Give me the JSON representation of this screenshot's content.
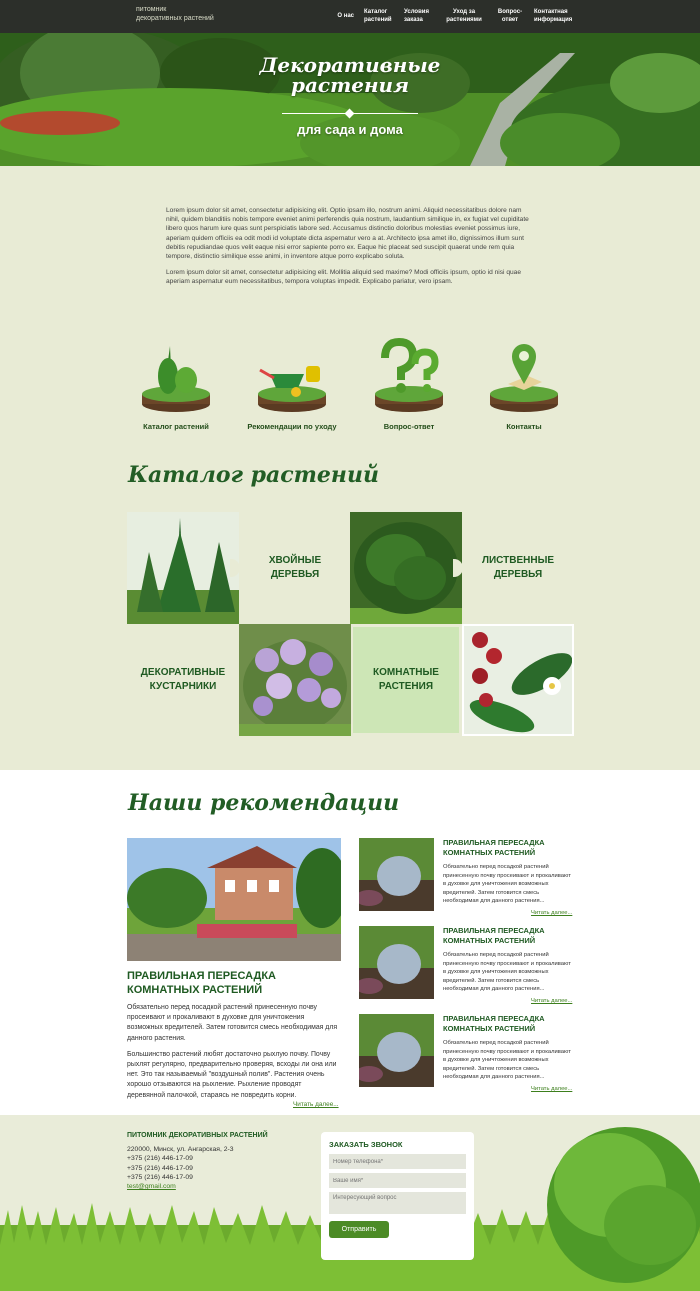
{
  "header": {
    "brand_line1": "питомник",
    "brand_line2": "декоративных растений",
    "nav": [
      "О нас",
      "Каталог растений",
      "Условия заказа",
      "Уход за растениями",
      "Вопрос-ответ",
      "Контактная информация"
    ]
  },
  "hero": {
    "title_line1": "Декоративные",
    "title_line2": "растения",
    "subtitle": "для сада и дома"
  },
  "intro": {
    "p1": "Lorem ipsum dolor sit amet, consectetur adipisicing elit. Optio ipsam illo, nostrum animi. Aliquid necessitatibus dolore nam nihil, quidem blanditiis nobis tempore eveniet animi perferendis quia nostrum, laudantium similique in, ex fugiat vel cupiditate libero quos harum iure quas sunt perspiciatis labore sed. Accusamus distinctio doloribus molestias eveniet possimus iure, aperiam quidem officiis ea odit modi id voluptate dicta aspernatur vero a at. Architecto ipsa amet illo, dignissimos illum sunt debitis repudiandae quos velit eaque nisi error sapiente porro ex. Eaque hic placeat sed suscipit quaerat unde rem quia tempore, distinctio similique esse animi, in inventore atque porro explicabo soluta.",
    "p2": "Lorem ipsum dolor sit amet, consectetur adipisicing elit. Mollitia aliquid sed maxime? Modi officiis ipsum, optio id nisi quae aperiam aspernatur eum necessitatibus, tempora voluptas impedit. Explicabo pariatur, vero ipsam."
  },
  "features": [
    "Каталог растений",
    "Рекомендации по уходу",
    "Вопрос-ответ",
    "Контакты"
  ],
  "catalog": {
    "title": "Каталог растений",
    "items": [
      {
        "line1": "ХВОЙНЫЕ",
        "line2": "ДЕРЕВЬЯ"
      },
      {
        "line1": "ЛИСТВЕННЫЕ",
        "line2": "ДЕРЕВЬЯ"
      },
      {
        "line1": "ДЕКОРАТИВНЫЕ",
        "line2": "КУСТАРНИКИ"
      },
      {
        "line1": "КОМНАТНЫЕ",
        "line2": "РАСТЕНИЯ"
      }
    ]
  },
  "recommendations": {
    "title": "Наши рекомендации",
    "main": {
      "heading_line1": "ПРАВИЛЬНАЯ ПЕРЕСАДКА",
      "heading_line2": "КОМНАТНЫХ РАСТЕНИЙ",
      "p1": "Обязательно перед посадкой растений принесенную почву просеивают и прокаливают в духовке для уничтожения возможных вредителей. Затем готовится смесь необходимая для данного растения.",
      "p2": "Большинство растений любят достаточно рыхлую почву. Почву рыхлят регулярно, предварительно проверяя, всходы ли она или нет. Это так называемый \"воздушный полив\". Растения очень хорошо отзываются на рыхление. Рыхление проводят деревянной палочкой, стараясь не повредить корни.",
      "read_more": "Читать далее..."
    },
    "side": [
      {
        "heading_line1": "ПРАВИЛЬНАЯ ПЕРЕСАДКА",
        "heading_line2": "КОМНАТНЫХ РАСТЕНИЙ",
        "text": "Обязательно перед посадкой растений принесенную почву просеивают и прокаливают в духовке для уничтожения возможных вредителей. Затем готовится смесь необходимая для данного растения...",
        "read_more": "Читать далее..."
      },
      {
        "heading_line1": "ПРАВИЛЬНАЯ ПЕРЕСАДКА",
        "heading_line2": "КОМНАТНЫХ РАСТЕНИЙ",
        "text": "Обязательно перед посадкой растений принесенную почву просеивают и прокаливают в духовке для уничтожения возможных вредителей. Затем готовится смесь необходимая для данного растения...",
        "read_more": "Читать далее..."
      },
      {
        "heading_line1": "ПРАВИЛЬНАЯ ПЕРЕСАДКА",
        "heading_line2": "КОМНАТНЫХ РАСТЕНИЙ",
        "text": "Обязательно перед посадкой растений принесенную почву просеивают и прокаливают в духовке для уничтожения возможных вредителей. Затем готовится смесь необходимая для данного растения...",
        "read_more": "Читать далее..."
      }
    ]
  },
  "footer": {
    "title": "ПИТОМНИК ДЕКОРАТИВНЫХ РАСТЕНИЙ",
    "address": "220000, Минск, ул. Ангарская, 2-3",
    "phone1": "+375 (216) 446-17-09",
    "phone2": "+375 (216) 446-17-09",
    "phone3": "+375 (216) 446-17-09",
    "email": "test@gmail.com"
  },
  "callback": {
    "title": "ЗАКАЗАТЬ ЗВОНОК",
    "phone_placeholder": "Номер телефона*",
    "name_placeholder": "Ваше имя*",
    "question_placeholder": "Интересующий вопрос",
    "submit_label": "Отправить"
  },
  "colors": {
    "accent": "#1f5a22",
    "background": "#e8ebd5",
    "button": "#4c8b26",
    "link": "#3d7f1d"
  }
}
